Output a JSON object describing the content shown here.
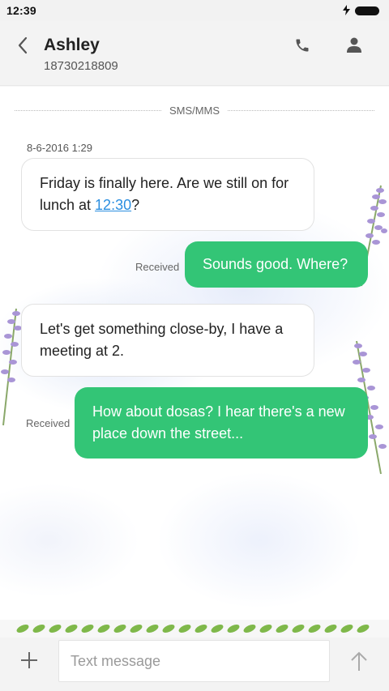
{
  "status_bar": {
    "time": "12:39",
    "charging_icon": "bolt-icon",
    "battery_icon": "battery-icon"
  },
  "header": {
    "contact_name": "Ashley",
    "contact_number": "18730218809",
    "back_icon": "chevron-left-icon",
    "call_icon": "phone-icon",
    "profile_icon": "person-icon"
  },
  "conversation": {
    "channel_label": "SMS/MMS",
    "timestamp": "8-6-2016 1:29",
    "messages": [
      {
        "direction": "incoming",
        "text_before": "Friday is finally here. Are we still on for lunch at ",
        "link": "12:30",
        "text_after": "?"
      },
      {
        "direction": "outgoing",
        "text": "Sounds good. Where?",
        "status": "Received"
      },
      {
        "direction": "incoming",
        "text": "Let's get something close-by, I have a meeting at 2."
      },
      {
        "direction": "outgoing",
        "text": "How about dosas? I hear there's a new place down the street...",
        "status": "Received"
      }
    ]
  },
  "composer": {
    "placeholder": "Text message",
    "value": "",
    "add_icon": "plus-icon",
    "send_icon": "arrow-up-icon"
  },
  "colors": {
    "outgoing_bubble": "#33c576",
    "incoming_bubble": "#ffffff",
    "link": "#2a8ee0",
    "background": "#f6f6f6"
  }
}
